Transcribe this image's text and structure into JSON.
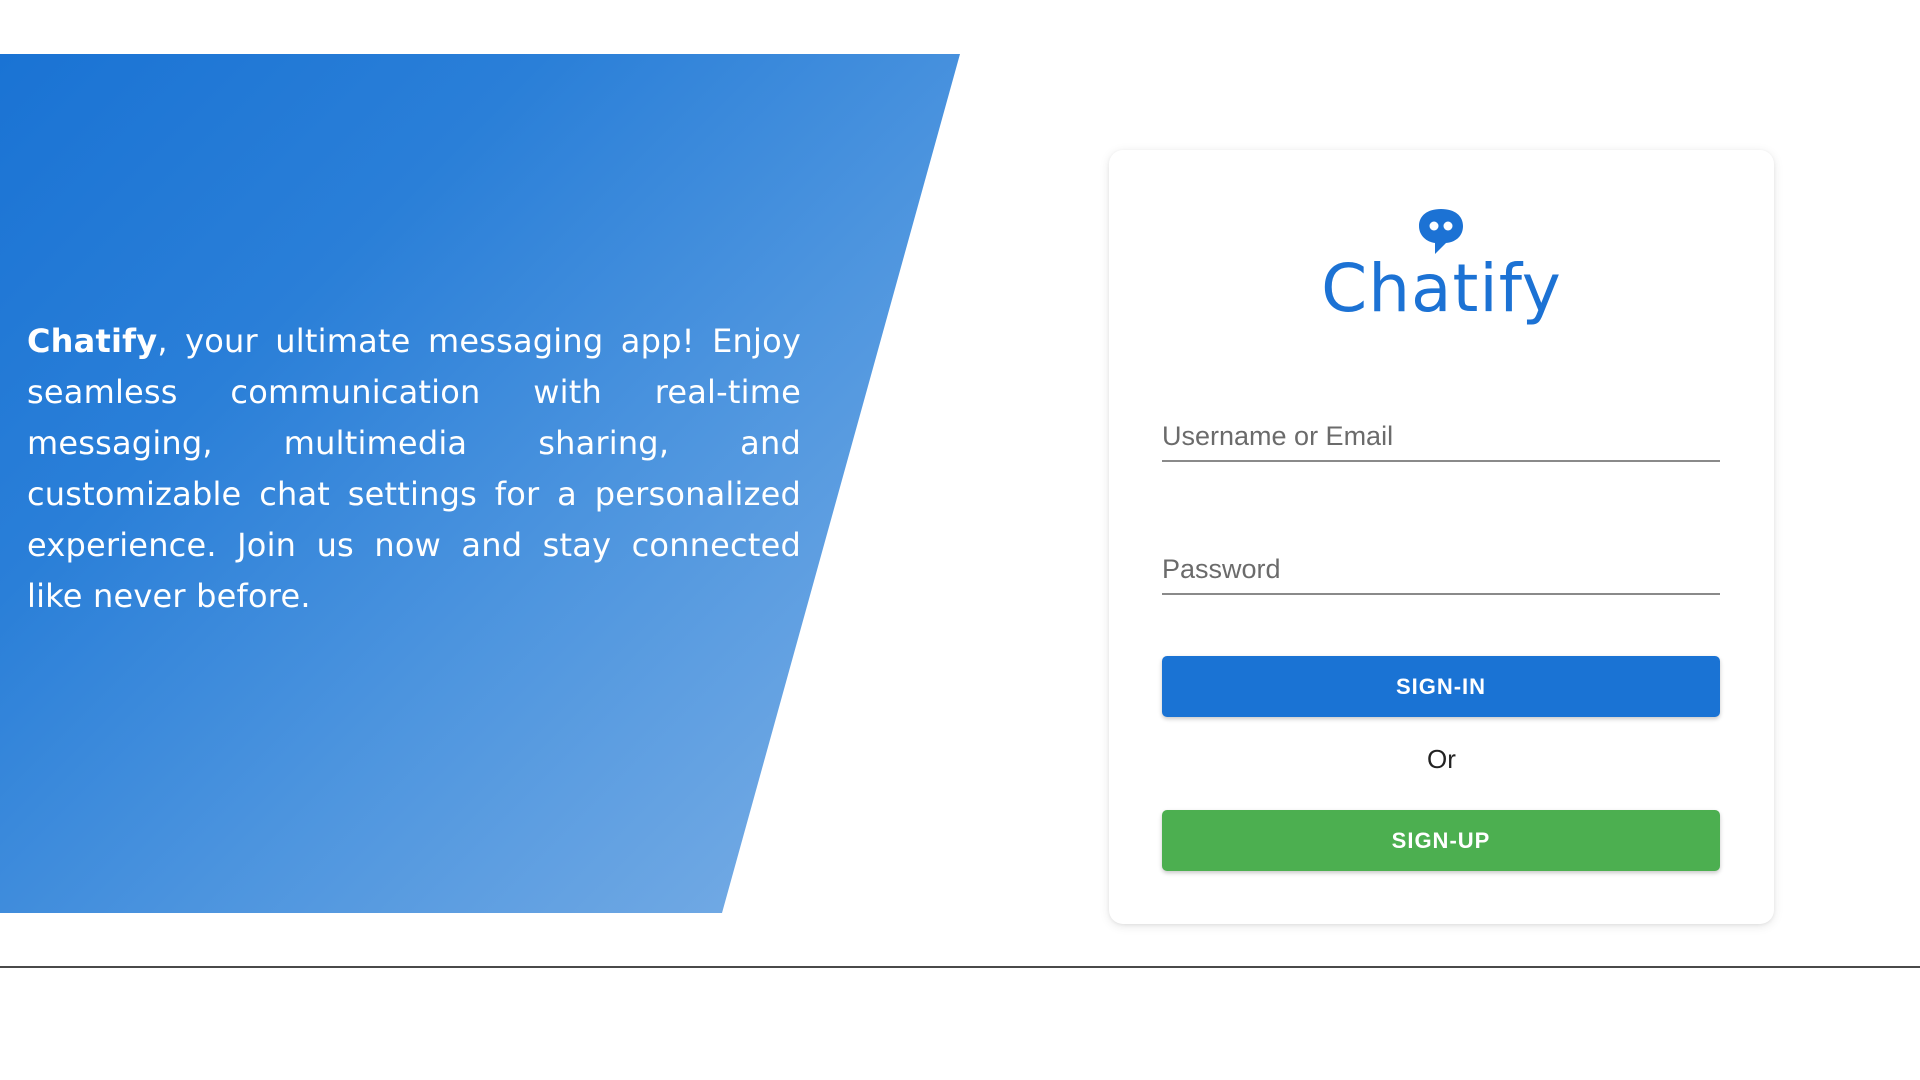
{
  "hero": {
    "brand": "Chatify",
    "tagline": ", your ultimate messaging app! Enjoy seamless communication with real-time messaging, multimedia sharing, and customizable chat settings for a personalized experience. Join us now and stay connected like never before."
  },
  "login_card": {
    "logo_icon": "chat-bubble-icon",
    "title": "Chatify",
    "username_placeholder": "Username or Email",
    "username_value": "",
    "password_placeholder": "Password",
    "password_value": "",
    "signin_label": "SIGN-IN",
    "divider_text": "Or",
    "signup_label": "SIGN-UP"
  },
  "colors": {
    "primary": "#1a73d4",
    "success": "#4caf50",
    "hero_gradient_start": "#1a73d4",
    "hero_gradient_end": "#7fb1e6"
  }
}
